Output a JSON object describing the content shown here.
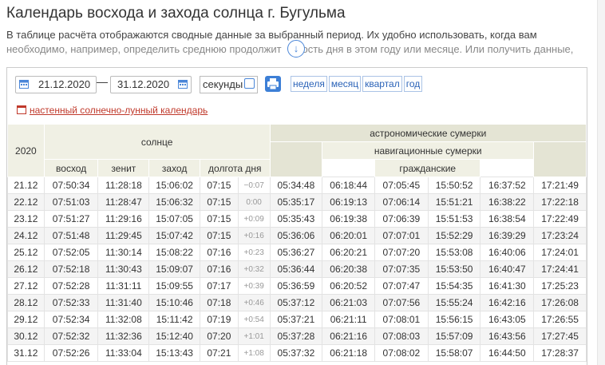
{
  "page": {
    "title": "Календарь восхода и захода солнца г. Бугульма",
    "desc_line1": "В таблице расчёта отображаются сводные данные за выбранный период. Их удобно использовать, когда вам",
    "desc_line2": "необходимо, например, определить среднюю продолжит  ость дня в этом году или месяце. Или получить данные,",
    "scroll_icon": "arrow-down-circle-icon"
  },
  "controls": {
    "date_from": "21.12.2020",
    "date_to": "31.12.2020",
    "dash": "—",
    "seconds_label": "секунды",
    "seconds_checked": false,
    "periods": [
      "неделя",
      "месяц",
      "квартал",
      "год"
    ],
    "moon_link": "настенный солнечно-лунный календарь"
  },
  "colors": {
    "accent": "#3d7fd6",
    "link_red": "#c0392b",
    "header_bg": "#f0f0e4",
    "header_dark": "#e4e4d4"
  },
  "table": {
    "year": "2020",
    "sun_header": "солнце",
    "astro_header": "астрономические сумерки",
    "nav_header": "навигационные сумерки",
    "civil_header": "гражданские",
    "cols": {
      "sunrise": "восход",
      "zenith": "зенит",
      "sunset": "заход",
      "daylength": "долгота дня"
    },
    "rows": [
      [
        "21.12",
        "07:50:34",
        "11:28:18",
        "15:06:02",
        "07:15",
        "−0:07",
        "05:34:48",
        "06:18:44",
        "07:05:45",
        "15:50:52",
        "16:37:52",
        "17:21:49"
      ],
      [
        "22.12",
        "07:51:03",
        "11:28:47",
        "15:06:32",
        "07:15",
        "0:00",
        "05:35:17",
        "06:19:13",
        "07:06:14",
        "15:51:21",
        "16:38:22",
        "17:22:18"
      ],
      [
        "23.12",
        "07:51:27",
        "11:29:16",
        "15:07:05",
        "07:15",
        "+0:09",
        "05:35:43",
        "06:19:38",
        "07:06:39",
        "15:51:53",
        "16:38:54",
        "17:22:49"
      ],
      [
        "24.12",
        "07:51:48",
        "11:29:45",
        "15:07:42",
        "07:15",
        "+0:16",
        "05:36:06",
        "06:20:01",
        "07:07:01",
        "15:52:29",
        "16:39:29",
        "17:23:24"
      ],
      [
        "25.12",
        "07:52:05",
        "11:30:14",
        "15:08:22",
        "07:16",
        "+0:23",
        "05:36:27",
        "06:20:21",
        "07:07:20",
        "15:53:08",
        "16:40:06",
        "17:24:01"
      ],
      [
        "26.12",
        "07:52:18",
        "11:30:43",
        "15:09:07",
        "07:16",
        "+0:32",
        "05:36:44",
        "06:20:38",
        "07:07:35",
        "15:53:50",
        "16:40:47",
        "17:24:41"
      ],
      [
        "27.12",
        "07:52:28",
        "11:31:11",
        "15:09:55",
        "07:17",
        "+0:39",
        "05:36:59",
        "06:20:52",
        "07:07:47",
        "15:54:35",
        "16:41:30",
        "17:25:23"
      ],
      [
        "28.12",
        "07:52:33",
        "11:31:40",
        "15:10:46",
        "07:18",
        "+0:46",
        "05:37:12",
        "06:21:03",
        "07:07:56",
        "15:55:24",
        "16:42:16",
        "17:26:08"
      ],
      [
        "29.12",
        "07:52:34",
        "11:32:08",
        "15:11:42",
        "07:19",
        "+0:54",
        "05:37:21",
        "06:21:11",
        "07:08:01",
        "15:56:15",
        "16:43:05",
        "17:26:55"
      ],
      [
        "30.12",
        "07:52:32",
        "11:32:36",
        "15:12:40",
        "07:20",
        "+1:01",
        "05:37:28",
        "06:21:16",
        "07:08:03",
        "15:57:09",
        "16:43:56",
        "17:27:45"
      ],
      [
        "31.12",
        "07:52:26",
        "11:33:04",
        "15:13:43",
        "07:21",
        "+1:08",
        "05:37:32",
        "06:21:18",
        "07:08:02",
        "15:58:07",
        "16:44:50",
        "17:28:37"
      ]
    ]
  }
}
